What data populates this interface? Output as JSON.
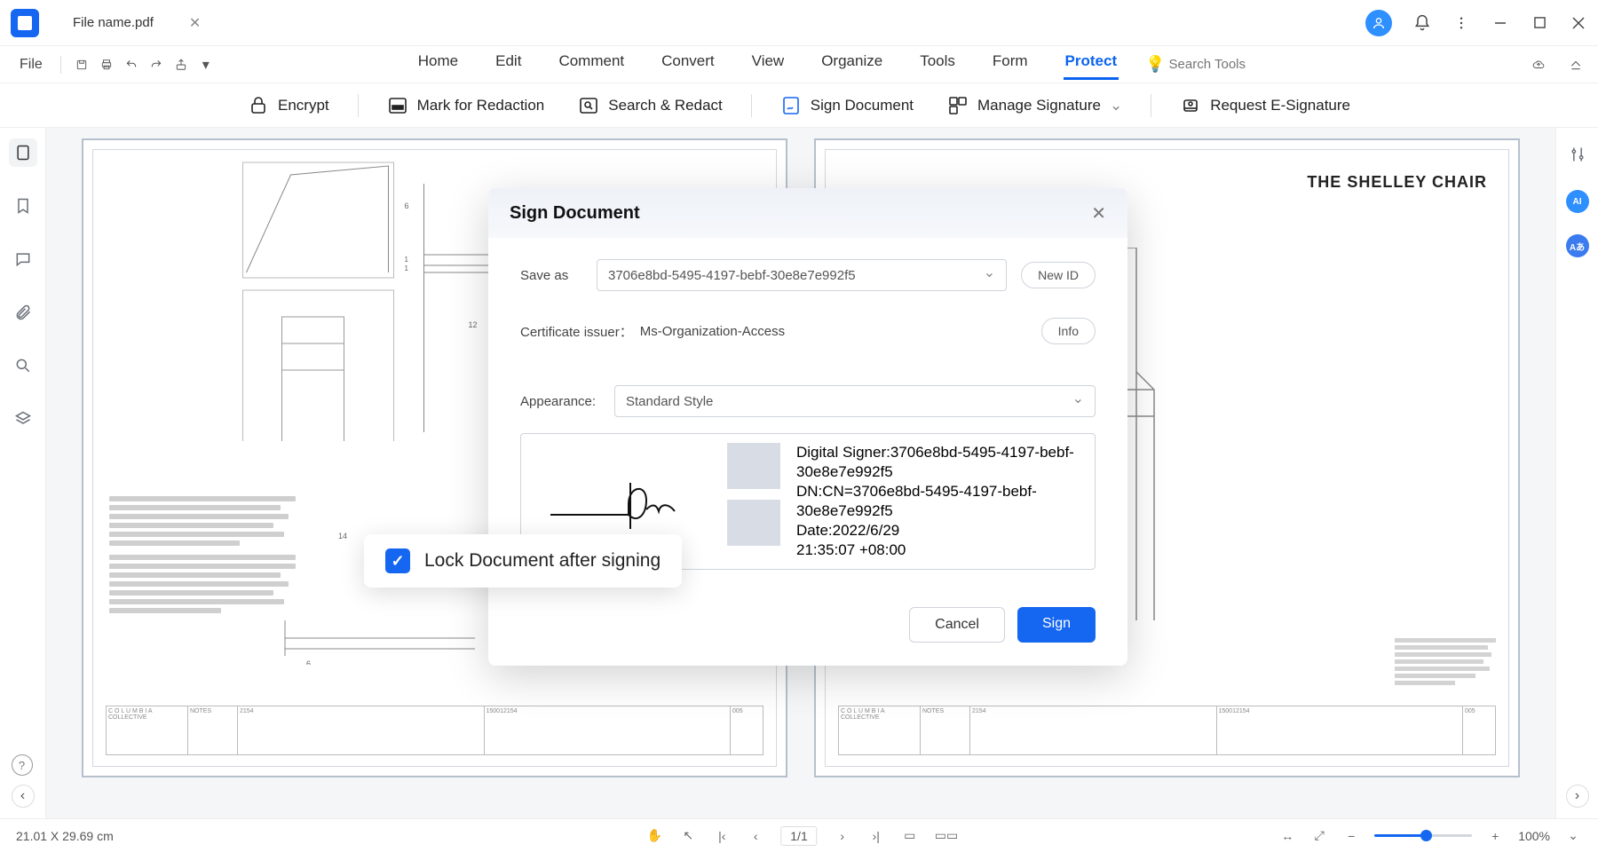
{
  "titlebar": {
    "file_name": "File name.pdf"
  },
  "menu": {
    "file": "File",
    "tabs": [
      "Home",
      "Edit",
      "Comment",
      "Convert",
      "View",
      "Organize",
      "Tools",
      "Form",
      "Protect"
    ],
    "active_tab": "Protect",
    "search_placeholder": "Search Tools"
  },
  "ribbon": {
    "encrypt": "Encrypt",
    "mark_redaction": "Mark for Redaction",
    "search_redact": "Search & Redact",
    "sign_document": "Sign Document",
    "manage_signature": "Manage Signature",
    "request_esig": "Request E-Signature"
  },
  "dialog": {
    "title": "Sign Document",
    "save_as_label": "Save as",
    "save_as_value": "3706e8bd-5495-4197-bebf-30e8e7e992f5",
    "new_id": "New ID",
    "cert_issuer_label": "Certificate issuer：",
    "cert_issuer_value": "Ms-Organization-Access",
    "info": "Info",
    "appearance_label": "Appearance:",
    "appearance_value": "Standard Style",
    "preview": {
      "line1": "Digital Signer:3706e8bd-5495-4197-bebf-30e8e7e992f5",
      "line2": "DN:CN=3706e8bd-5495-4197-bebf-30e8e7e992f5",
      "line3": "Date:2022/6/29",
      "line4": " 21:35:07 +08:00"
    },
    "lock_label": "Lock Document after signing",
    "cancel": "Cancel",
    "sign": "Sign"
  },
  "page2_title": "THE SHELLEY CHAIR",
  "statusbar": {
    "dims": "21.01 X 29.69 cm",
    "page_indicator": "1/1",
    "zoom": "100%"
  }
}
